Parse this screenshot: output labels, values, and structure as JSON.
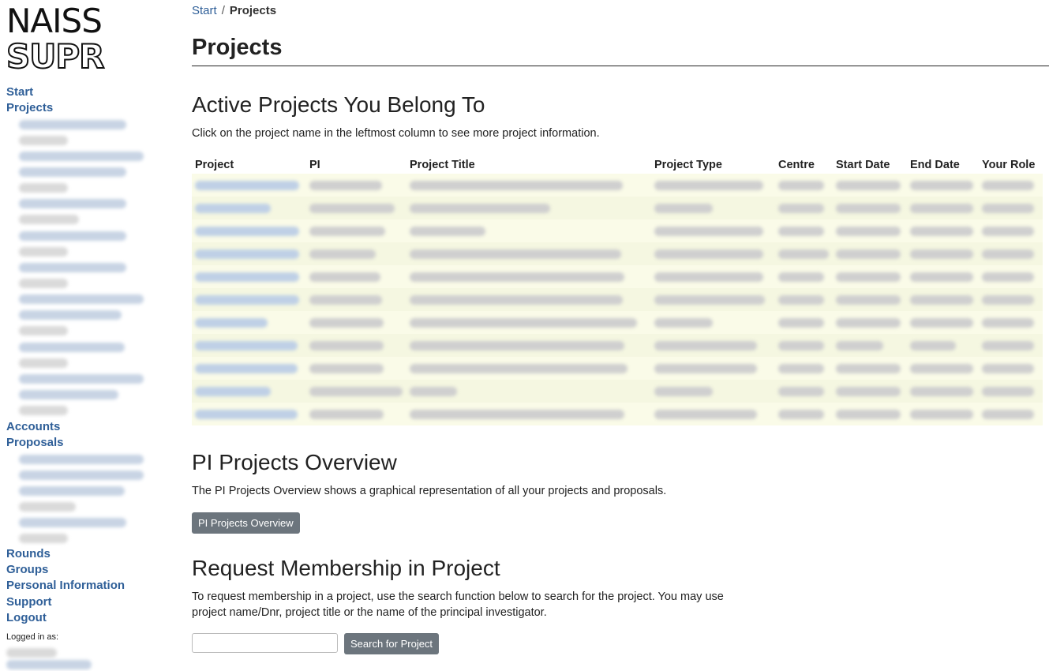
{
  "logo": {
    "line1": "NAISS",
    "line2": "SUPR"
  },
  "nav": {
    "start": "Start",
    "projects": "Projects",
    "accounts": "Accounts",
    "proposals": "Proposals",
    "rounds": "Rounds",
    "groups": "Groups",
    "personal_information": "Personal Information",
    "support": "Support",
    "logout": "Logout",
    "logged_in_label": "Logged in as:"
  },
  "breadcrumb": {
    "start": "Start",
    "separator": "/",
    "current": "Projects"
  },
  "page_title": "Projects",
  "active_projects": {
    "title": "Active Projects You Belong To",
    "intro": "Click on the project name in the leftmost column to see more project information.",
    "columns": [
      "Project",
      "PI",
      "Project Title",
      "Project Type",
      "Centre",
      "Start Date",
      "End Date",
      "Your Role"
    ]
  },
  "pi_overview": {
    "title": "PI Projects Overview",
    "text": "The PI Projects Overview shows a graphical representation of all your projects and proposals.",
    "button": "PI Projects Overview"
  },
  "request_membership": {
    "title": "Request Membership in Project",
    "text_line1": "To request membership in a project, use the search function below to search for the project. You may use",
    "text_line2": "project name/Dnr, project title or the name of the principal investigator.",
    "search_value": "",
    "button": "Search for Project"
  },
  "colors": {
    "link": "#2f5f98",
    "button_bg": "#6c757d",
    "row_bg": "#fafbe8"
  }
}
